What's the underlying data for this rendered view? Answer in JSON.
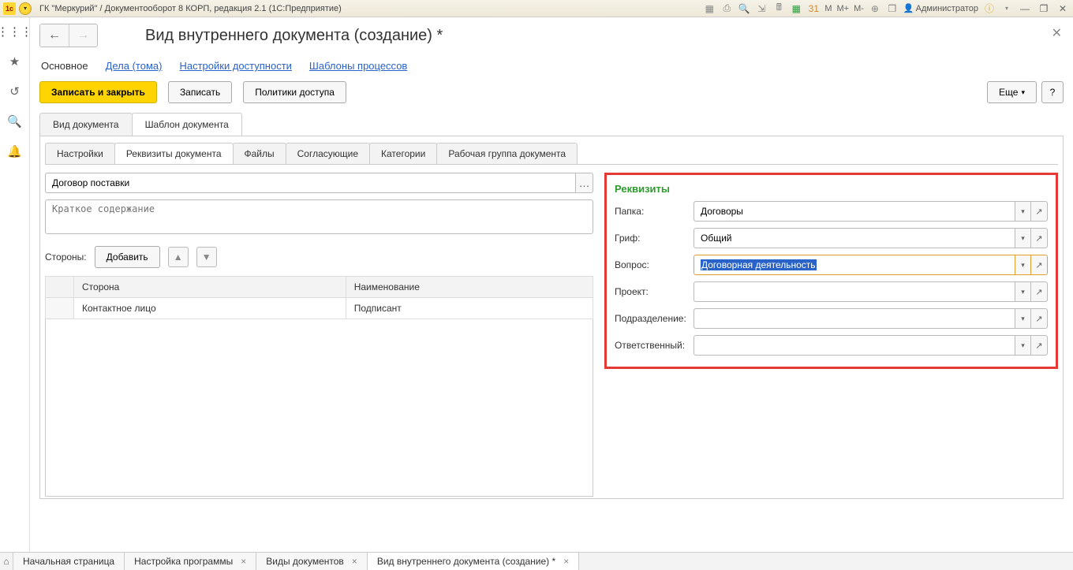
{
  "window": {
    "title": "ГК \"Меркурий\" / Документооборот 8 КОРП, редакция 2.1  (1С:Предприятие)",
    "user": "Администратор"
  },
  "toolbar_icons": {
    "m": "M",
    "m_plus": "M+",
    "m_minus": "M-"
  },
  "page": {
    "title": "Вид внутреннего документа (создание) *"
  },
  "nav_links": [
    "Основное",
    "Дела (тома)",
    "Настройки доступности",
    "Шаблоны процессов"
  ],
  "actions": {
    "save_close": "Записать и закрыть",
    "save": "Записать",
    "policies": "Политики доступа",
    "more": "Еще",
    "help": "?"
  },
  "tabs1": [
    "Вид документа",
    "Шаблон документа"
  ],
  "tabs2": [
    "Настройки",
    "Реквизиты документа",
    "Файлы",
    "Согласующие",
    "Категории",
    "Рабочая группа документа"
  ],
  "doc_name": "Договор поставки",
  "summary_placeholder": "Краткое содержание",
  "sides": {
    "label": "Стороны:",
    "add": "Добавить",
    "cols": [
      "Сторона",
      "Наименование"
    ],
    "rows": [
      [
        "Контактное лицо",
        "Подписант"
      ]
    ]
  },
  "rekv": {
    "title": "Реквизиты",
    "fields": {
      "folder": {
        "label": "Папка:",
        "value": "Договоры"
      },
      "grif": {
        "label": "Гриф:",
        "value": "Общий"
      },
      "question": {
        "label": "Вопрос:",
        "value": "Договорная деятельность"
      },
      "project": {
        "label": "Проект:",
        "value": ""
      },
      "dept": {
        "label": "Подразделение:",
        "value": ""
      },
      "resp": {
        "label": "Ответственный:",
        "value": ""
      }
    }
  },
  "bottom_tabs": [
    {
      "label": "Начальная страница",
      "closable": false
    },
    {
      "label": "Настройка программы",
      "closable": true
    },
    {
      "label": "Виды документов",
      "closable": true
    },
    {
      "label": "Вид внутреннего документа (создание) *",
      "closable": true,
      "active": true
    }
  ]
}
